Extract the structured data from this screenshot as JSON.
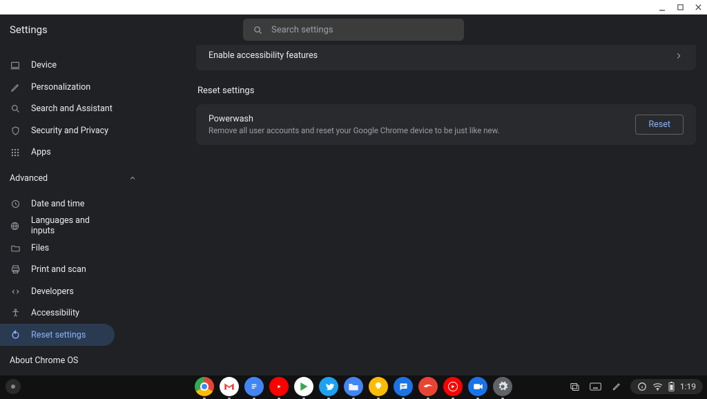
{
  "window": {
    "title": "Settings"
  },
  "header": {
    "title": "Settings"
  },
  "search": {
    "placeholder": "Search settings"
  },
  "sidebar": {
    "items": [
      {
        "label": "Device",
        "icon": "laptop"
      },
      {
        "label": "Personalization",
        "icon": "pencil"
      },
      {
        "label": "Search and Assistant",
        "icon": "magnify"
      },
      {
        "label": "Security and Privacy",
        "icon": "shield"
      },
      {
        "label": "Apps",
        "icon": "grid"
      }
    ],
    "advanced_label": "Advanced",
    "advanced_items": [
      {
        "label": "Date and time",
        "icon": "clock"
      },
      {
        "label": "Languages and inputs",
        "icon": "globe"
      },
      {
        "label": "Files",
        "icon": "folder"
      },
      {
        "label": "Print and scan",
        "icon": "print"
      },
      {
        "label": "Developers",
        "icon": "code"
      },
      {
        "label": "Accessibility",
        "icon": "accessibility"
      },
      {
        "label": "Reset settings",
        "icon": "reset",
        "active": true
      }
    ],
    "about_label": "About Chrome OS"
  },
  "main": {
    "accessibility_row": "Enable accessibility features",
    "reset_section_title": "Reset settings",
    "powerwash_title": "Powerwash",
    "powerwash_desc": "Remove all user accounts and reset your Google Chrome device to be just like new.",
    "reset_button": "Reset"
  },
  "shelf": {
    "apps": [
      {
        "name": "chrome",
        "bg": "#fff"
      },
      {
        "name": "gmail",
        "bg": "#fff"
      },
      {
        "name": "docs",
        "bg": "#4285f4"
      },
      {
        "name": "youtube",
        "bg": "#ff0000"
      },
      {
        "name": "play",
        "bg": "#fff"
      },
      {
        "name": "twitter",
        "bg": "#1da1f2"
      },
      {
        "name": "files",
        "bg": "#4285f4"
      },
      {
        "name": "keep",
        "bg": "#fbbc04"
      },
      {
        "name": "messages",
        "bg": "#1a73e8"
      },
      {
        "name": "stadia",
        "bg": "#ea4335"
      },
      {
        "name": "ytmusic",
        "bg": "#ff0000"
      },
      {
        "name": "duo",
        "bg": "#1a73e8"
      },
      {
        "name": "settings",
        "bg": "#5f6368"
      }
    ],
    "clock": "1:19"
  }
}
